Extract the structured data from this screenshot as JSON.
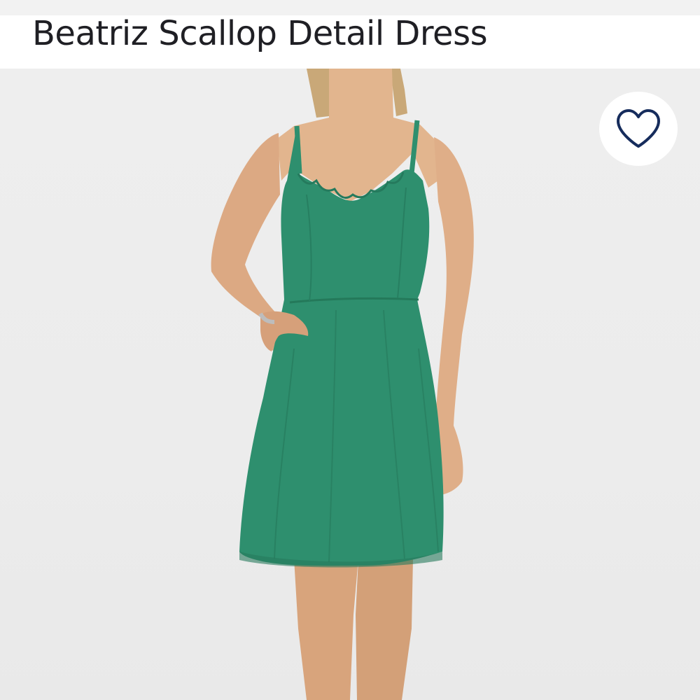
{
  "product": {
    "title": "Beatriz Scallop Detail Dress"
  },
  "image": {
    "subject": "product-photo",
    "dress_color": "#2e8f6e",
    "background_color": "#ececec"
  },
  "favorite": {
    "icon": "heart-outline-icon",
    "color": "#162c5c"
  }
}
